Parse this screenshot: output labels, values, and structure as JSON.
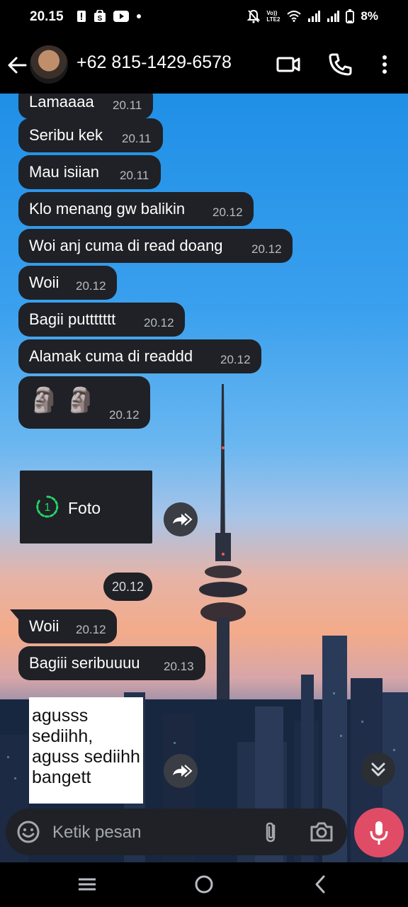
{
  "status_bar": {
    "time": "20.15",
    "signal_label": "Vo)) LTE2",
    "battery": "8%"
  },
  "header": {
    "contact": "+62 815-1429-6578",
    "icons": [
      "back-arrow-icon",
      "video-call-icon",
      "voice-call-icon",
      "more-vert-icon"
    ]
  },
  "messages": [
    {
      "text": "Lamaaaa",
      "time": "20.11"
    },
    {
      "text": "Seribu kek",
      "time": "20.11"
    },
    {
      "text": "Mau isiian",
      "time": "20.11"
    },
    {
      "text": "Klo menang gw balikin",
      "time": "20.12"
    },
    {
      "text": "Woi anj cuma di read doang",
      "time": "20.12"
    },
    {
      "text": "Woii",
      "time": "20.12"
    },
    {
      "text": "Bagii puttttttt",
      "time": "20.12"
    },
    {
      "text": "Alamak cuma di readdd",
      "time": "20.12"
    },
    {
      "text": "🗿 🗿",
      "time": "20.12"
    }
  ],
  "media": {
    "label": "Foto",
    "view_once_number": "1",
    "time": "20.12"
  },
  "messages_after": [
    {
      "text": "Woii",
      "time": "20.12"
    },
    {
      "text": "Bagiii seribuuuu",
      "time": "20.13"
    }
  ],
  "image_text": "agusss sediihh, aguss sediihh bangett",
  "input": {
    "placeholder": "Ketik pesan"
  },
  "colors": {
    "bubble": "#1f2126",
    "mic_button": "#e04c66",
    "view_once_green": "#25d366"
  }
}
